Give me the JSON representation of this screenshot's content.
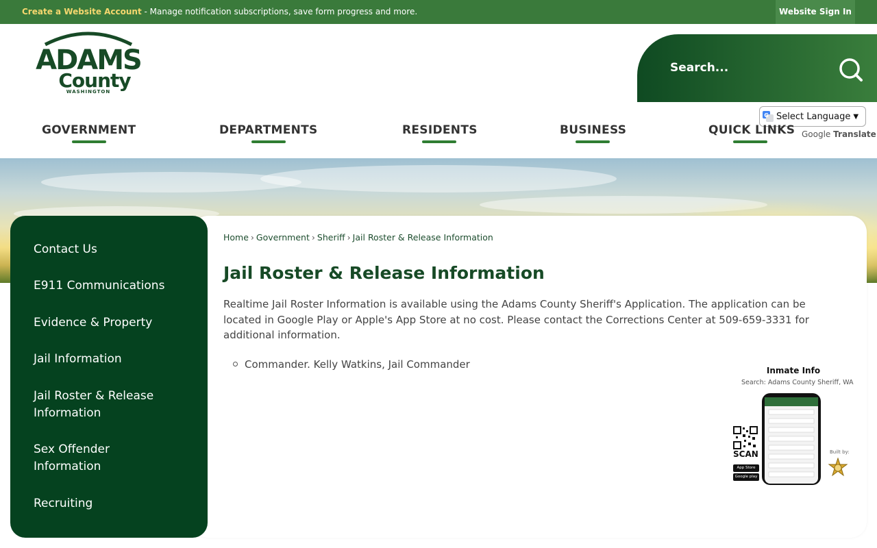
{
  "topbar": {
    "create_link": "Create a Website Account",
    "message": " - Manage notification subscriptions, save form progress and more.",
    "signin": "Website Sign In"
  },
  "logo": {
    "line1": "ADAMS",
    "line2": "County",
    "line3": "WASHINGTON"
  },
  "search": {
    "placeholder": "Search..."
  },
  "translate": {
    "select_label": "Select Language",
    "powered_google": "Google",
    "powered_translate": "Translate"
  },
  "nav": {
    "items": [
      "GOVERNMENT",
      "DEPARTMENTS",
      "RESIDENTS",
      "BUSINESS",
      "QUICK LINKS"
    ]
  },
  "sidebar": {
    "items": [
      "Contact Us",
      "E911 Communications",
      "Evidence & Property",
      "Jail Information",
      "Jail Roster & Release Information",
      "Sex Offender Information",
      "Recruiting"
    ]
  },
  "breadcrumb": {
    "items": [
      "Home",
      "Government",
      "Sheriff",
      "Jail Roster & Release Information"
    ],
    "separator": "›"
  },
  "page": {
    "title": "Jail Roster & Release Information",
    "body": "Realtime Jail Roster Information is available using the Adams County Sheriff's Application. The application can be located in Google Play or Apple's App Store at no cost. Please contact the Corrections Center at 509-659-3331 for additional information.",
    "bullets": [
      "Commander. Kelly Watkins, Jail Commander"
    ]
  },
  "promo": {
    "title": "Inmate Info",
    "subtitle": "Search: Adams County Sheriff, WA",
    "scan": "SCAN",
    "built_by": "Built by:",
    "app_store": "App Store",
    "google_play": "Google play"
  },
  "colors": {
    "topbar": "#3a7a3b",
    "brand_dark": "#05421f",
    "accent": "#2f7d32",
    "link_highlight": "#f5d76e"
  }
}
